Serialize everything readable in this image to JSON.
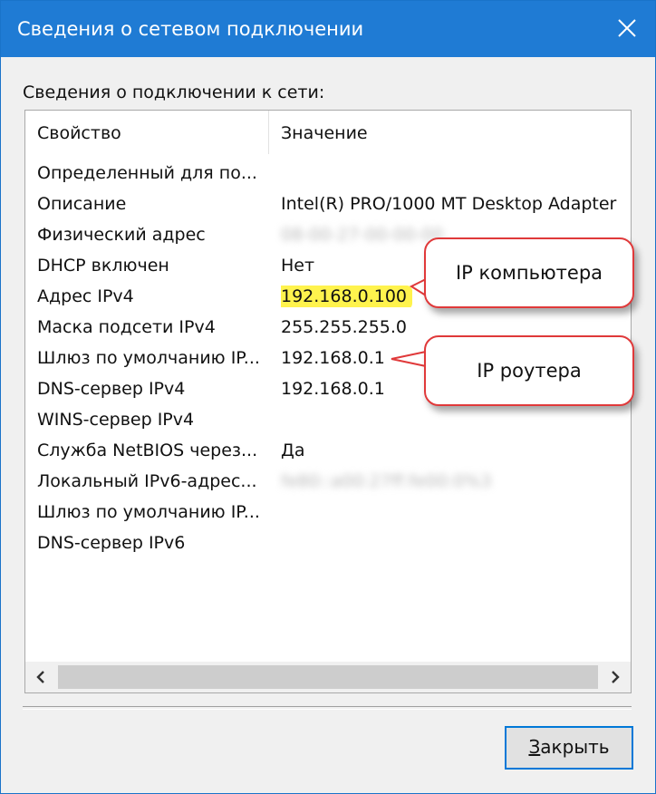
{
  "window": {
    "title": "Сведения о сетевом подключении",
    "close_icon": "close-icon"
  },
  "group_label": "Сведения о подключении к сети:",
  "columns": {
    "property": "Свойство",
    "value": "Значение"
  },
  "rows": [
    {
      "property": "Определенный для по...",
      "value": ""
    },
    {
      "property": "Описание",
      "value": "Intel(R) PRO/1000 MT Desktop Adapter"
    },
    {
      "property": "Физический адрес",
      "value": "08-00-27-00-00-00",
      "blurred": true
    },
    {
      "property": "DHCP включен",
      "value": "Нет"
    },
    {
      "property": "Адрес IPv4",
      "value": "192.168.0.100",
      "highlighted": true
    },
    {
      "property": "Маска подсети IPv4",
      "value": "255.255.255.0"
    },
    {
      "property": "Шлюз по умолчанию IP...",
      "value": "192.168.0.1"
    },
    {
      "property": "DNS-сервер IPv4",
      "value": "192.168.0.1"
    },
    {
      "property": "WINS-сервер IPv4",
      "value": ""
    },
    {
      "property": "Служба NetBIOS через...",
      "value": "Да"
    },
    {
      "property": "Локальный IPv6-адрес...",
      "value": "fe80::a00:27ff:fe00:0%3",
      "blurred": true
    },
    {
      "property": "Шлюз по умолчанию IP...",
      "value": ""
    },
    {
      "property": "DNS-сервер IPv6",
      "value": ""
    }
  ],
  "scrollbar": {
    "left_icon": "chevron-left-icon",
    "right_icon": "chevron-right-icon"
  },
  "close_button": {
    "mnemonic": "З",
    "rest": "акрыть"
  },
  "callouts": {
    "computer_ip": "IP компьютера",
    "router_ip": "IP роутера",
    "border_color": "#e0393a",
    "highlight_color": "#fff34d"
  }
}
